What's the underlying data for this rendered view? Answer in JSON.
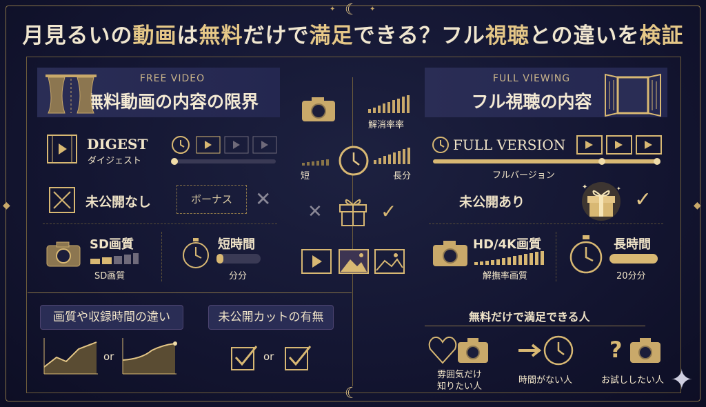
{
  "title": {
    "part1": "月見るいの",
    "part2": "動画",
    "part3": "は",
    "part4": "無料",
    "part5": "だけで",
    "part6": "満足",
    "part7": "できる？フル",
    "part8": "視聴",
    "part9": "との違いを",
    "part10": "検証"
  },
  "left": {
    "header_sub": "FREE VIDEO",
    "header_main": "無料動画の内容の限界",
    "digest": "DIGEST",
    "digest_kana": "ダイジェスト",
    "unreleased_none": "未公開なし",
    "bonus": "ボーナス",
    "sd_title": "SD画質",
    "sd_caption": "SD画質",
    "short_title": "短時間",
    "short_caption": "分分",
    "pill_quality": "画質や収録時間の違い",
    "pill_unreleased": "未公開カットの有無",
    "or1": "or",
    "or2": "or"
  },
  "center": {
    "resolution_label": "解消率率",
    "short_label": "短",
    "long_label": "長分"
  },
  "right": {
    "header_sub": "FULL VIEWING",
    "header_main": "フル視聴の内容",
    "full_version": "FULL VERSION",
    "full_version_kana": "フルバージョン",
    "unreleased_yes": "未公開あり",
    "hd_title": "HD/4K画質",
    "hd_caption": "解撫率画質",
    "long_title": "長時間",
    "long_caption": "20分分",
    "satisfied_heading": "無料だけで満足できる人",
    "person1_line1": "雰囲気だけ",
    "person1_line2": "知りたい人",
    "person2": "時間がない人",
    "person3": "お試ししたい人"
  },
  "colors": {
    "gold": "#d8b873",
    "navy": "#141632",
    "panel": "#2a2d55",
    "text": "#f0e4c8"
  },
  "icons": [
    "curtain-icon",
    "film-icon",
    "clock-icon",
    "play-icon",
    "box-x-icon",
    "cross-icon",
    "camera-icon",
    "timer-icon",
    "check-icon",
    "gift-icon",
    "window-icon",
    "image-icon",
    "heart-icon",
    "arrow-icon",
    "question-icon",
    "moon-icon",
    "sparkle-icon"
  ],
  "progress": {
    "digest_fraction": 0.05,
    "full_fraction": 1.0,
    "short_fraction": 0.15,
    "long_fraction": 1.0
  }
}
